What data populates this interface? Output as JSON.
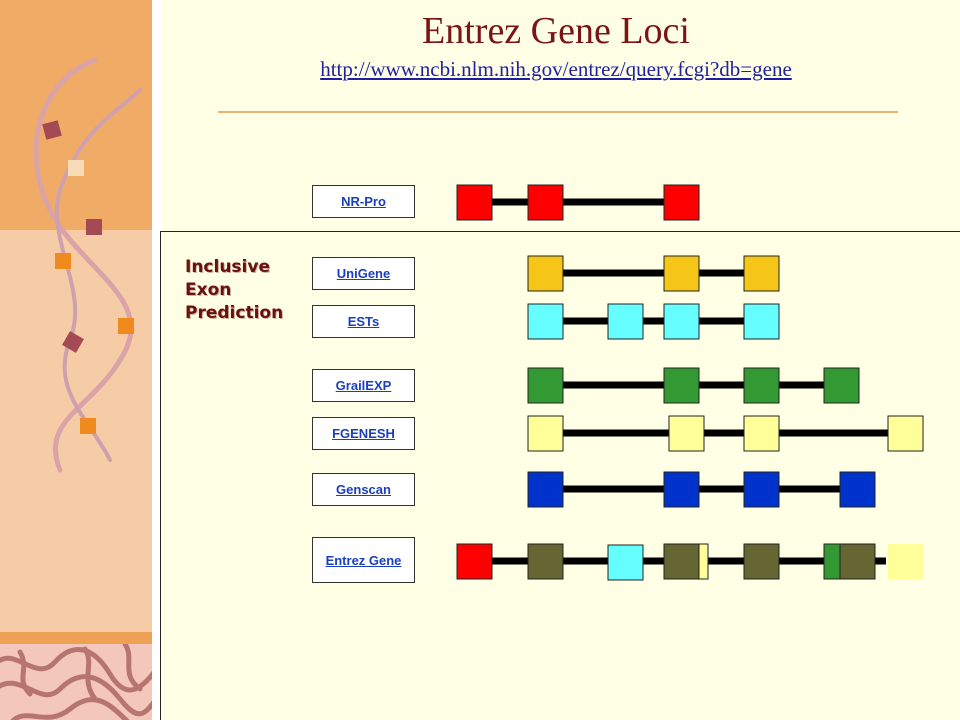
{
  "header": {
    "title": "Entrez Gene Loci",
    "url": "http://www.ncbi.nlm.nih.gov/entrez/query.fcgi?db=gene"
  },
  "side_label": {
    "lines": [
      "Inclusive",
      "Exon",
      "Prediction"
    ]
  },
  "tracks": [
    {
      "name": "NR-Pro",
      "color": "#ff0000"
    },
    {
      "name": "UniGene",
      "color": "#f5c518"
    },
    {
      "name": "ESTs",
      "color": "#66ffff"
    },
    {
      "name": "GrailEXP",
      "color": "#339933"
    },
    {
      "name": "FGENESH",
      "color": "#ffff99"
    },
    {
      "name": "Genscan",
      "color": "#0033cc"
    },
    {
      "name": "Entrez Gene",
      "color": "#666633"
    }
  ],
  "colors": {
    "title": "#7a1416",
    "url": "#1f1fa0",
    "side_label": "#6b0f10",
    "intron_line": "#000000",
    "sidebar_upper": "#f0ac67",
    "sidebar_lower": "#f6cca6"
  }
}
